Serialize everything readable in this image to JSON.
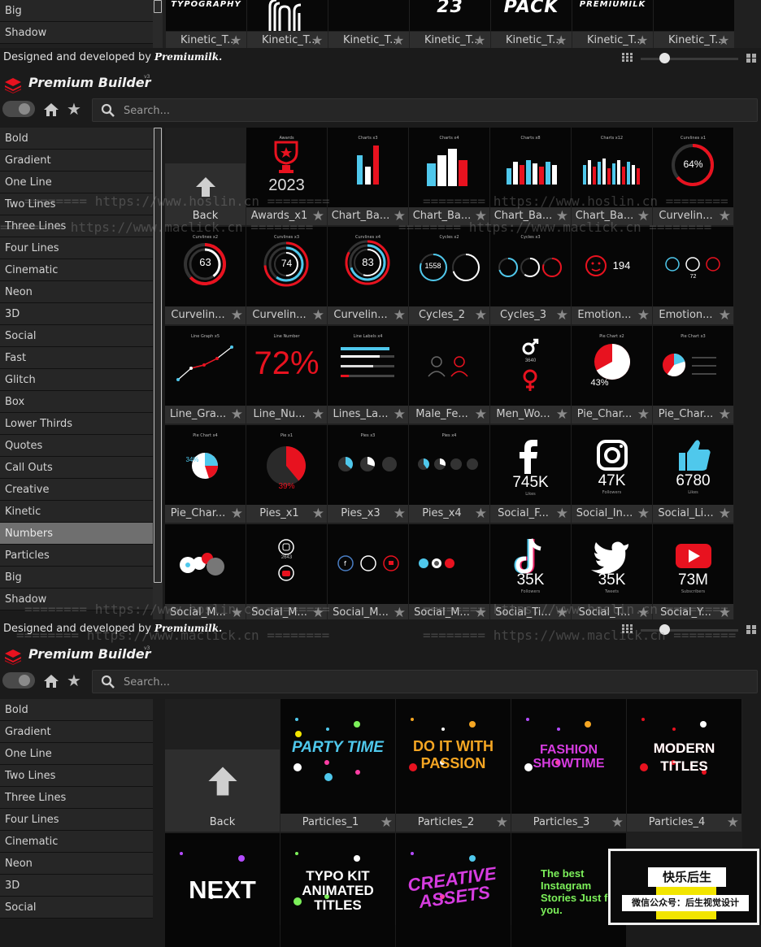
{
  "top_strip": {
    "sidebar_items": [
      "Big",
      "Shadow"
    ],
    "tiles": [
      {
        "label": "Kinetic_T...",
        "art": "TYPOGRAPHY"
      },
      {
        "label": "Kinetic_T...",
        "art": ""
      },
      {
        "label": "Kinetic_T...",
        "art": ""
      },
      {
        "label": "Kinetic_T...",
        "art": "23"
      },
      {
        "label": "Kinetic_T...",
        "art": "PACK"
      },
      {
        "label": "Kinetic_T...",
        "art": "PREMIUMILK"
      },
      {
        "label": "Kinetic_T...",
        "art": ""
      }
    ]
  },
  "footer": {
    "credit_text": "Designed and developed by",
    "credit_brand": "Premiumilk."
  },
  "brand": {
    "name": "Premium Builder",
    "version": "v3"
  },
  "search": {
    "placeholder": "Search..."
  },
  "panel1": {
    "sidebar": [
      "Bold",
      "Gradient",
      "One Line",
      "Two Lines",
      "Three Lines",
      "Four Lines",
      "Cinematic",
      "Neon",
      "3D",
      "Social",
      "Fast",
      "Glitch",
      "Box",
      "Lower Thirds",
      "Quotes",
      "Call Outs",
      "Creative",
      "Kinetic",
      "Numbers",
      "Particles",
      "Big",
      "Shadow"
    ],
    "active_item": "Numbers",
    "back_label": "Back",
    "tiles": [
      {
        "label": "Awards_x1",
        "title": "Awards",
        "value": "2023"
      },
      {
        "label": "Chart_Ba...",
        "title": "Charts x3",
        "value": ""
      },
      {
        "label": "Chart_Ba...",
        "title": "Charts x4",
        "value": ""
      },
      {
        "label": "Chart_Ba...",
        "title": "Charts x8",
        "value": ""
      },
      {
        "label": "Chart_Ba...",
        "title": "Charts x12",
        "value": ""
      },
      {
        "label": "Curvelin...",
        "title": "Curvlines x1",
        "value": "64%"
      },
      {
        "label": "Curvelin...",
        "title": "Curvlines x2",
        "value": "63"
      },
      {
        "label": "Curvelin...",
        "title": "Curvlines x3",
        "value": "74"
      },
      {
        "label": "Curvelin...",
        "title": "Curvlines x4",
        "value": "83"
      },
      {
        "label": "Cycles_2",
        "title": "Cycles x2",
        "value": "1558"
      },
      {
        "label": "Cycles_3",
        "title": "Cycles x3",
        "value": ""
      },
      {
        "label": "Emotion...",
        "title": "",
        "value": "194"
      },
      {
        "label": "Emotion...",
        "title": "",
        "value": "72"
      },
      {
        "label": "Line_Gra...",
        "title": "Line Graph x5",
        "value": ""
      },
      {
        "label": "Line_Nu...",
        "title": "Line Number",
        "value": "72%"
      },
      {
        "label": "Lines_La...",
        "title": "Line Labels x4",
        "value": ""
      },
      {
        "label": "Male_Fe...",
        "title": "",
        "value": ""
      },
      {
        "label": "Men_Wo...",
        "title": "",
        "value": "3640"
      },
      {
        "label": "Pie_Char...",
        "title": "Pie Chart x2",
        "value": "43%"
      },
      {
        "label": "Pie_Char...",
        "title": "Pie Chart x3",
        "value": ""
      },
      {
        "label": "Pie_Char...",
        "title": "Pie Chart x4",
        "value": "34%"
      },
      {
        "label": "Pies_x1",
        "title": "Pie x1",
        "value": "39%"
      },
      {
        "label": "Pies_x3",
        "title": "Pies x3",
        "value": ""
      },
      {
        "label": "Pies_x4",
        "title": "Pies x4",
        "value": ""
      },
      {
        "label": "Social_F...",
        "title": "",
        "value": "745K",
        "sub": "Likes"
      },
      {
        "label": "Social_In...",
        "title": "",
        "value": "47K",
        "sub": "Followers"
      },
      {
        "label": "Social_Li...",
        "title": "",
        "value": "6780",
        "sub": "Likes"
      },
      {
        "label": "Social_M...",
        "title": "",
        "value": ""
      },
      {
        "label": "Social_M...",
        "title": "",
        "value": "2643"
      },
      {
        "label": "Social_M...",
        "title": "",
        "value": ""
      },
      {
        "label": "Social_M...",
        "title": "",
        "value": ""
      },
      {
        "label": "Social_Ti...",
        "title": "",
        "value": "35K",
        "sub": "Followers"
      },
      {
        "label": "Social_T...",
        "title": "",
        "value": "35K",
        "sub": "Tweets"
      },
      {
        "label": "Social_Y...",
        "title": "",
        "value": "73M",
        "sub": "Subscribers"
      }
    ]
  },
  "panel2": {
    "sidebar": [
      "Bold",
      "Gradient",
      "One Line",
      "Two Lines",
      "Three Lines",
      "Four Lines",
      "Cinematic",
      "Neon",
      "3D",
      "Social"
    ],
    "back_label": "Back",
    "tiles": [
      {
        "label": "Particles_1",
        "art": "PARTY TIME"
      },
      {
        "label": "Particles_2",
        "art": "DO IT WITH PASSION"
      },
      {
        "label": "Particles_3",
        "art": "FASHION SHOWTIME"
      },
      {
        "label": "Particles_4",
        "art": "MODERN TITLES"
      },
      {
        "label": "",
        "art": "NEXT"
      },
      {
        "label": "",
        "art": "TYPO KIT ANIMATED TITLES"
      },
      {
        "label": "",
        "art": "CREATIVE ASSETS"
      },
      {
        "label": "",
        "art": "The best Instagram Stories Just for you."
      }
    ]
  },
  "watermark": {
    "text1": "======== https://www.hoslin.cn ========",
    "text2": "======== https://www.maclick.cn ========"
  },
  "badge": {
    "line1": "快乐后生",
    "line2": "微信公众号：后生视觉设计"
  },
  "colors": {
    "accent_red": "#e8121f",
    "accent_blue": "#4fc8ec",
    "bg": "#1b1b1b",
    "active": "#6f6f6f"
  }
}
